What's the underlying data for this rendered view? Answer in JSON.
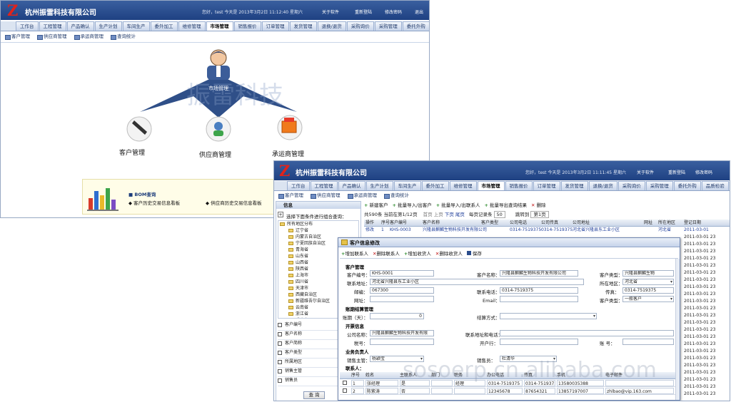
{
  "app": {
    "company": "杭州振雷科技有限公司",
    "logo_letter": "Z",
    "welcome_main": "您好，test 今天是 2013年3月2日 11:12:40 星期六",
    "welcome_detail": "您好，test 今天是 2013年3月2日 11:11:45 星期六",
    "links": [
      "关于软件",
      "重新登陆",
      "修改密码",
      "退出"
    ]
  },
  "tabs_main": [
    "工作台",
    "工程管理",
    "产品确认",
    "生产计划",
    "车间生产",
    "委外加工",
    "维修管理",
    "市场管理",
    "销售报价",
    "订单管理",
    "发货管理",
    "退换/退货",
    "采购询价",
    "采购管理",
    "委托外购"
  ],
  "tabs_detail": [
    "工作台",
    "工程管理",
    "产品确认",
    "生产计划",
    "车间生产",
    "委外加工",
    "维修管理",
    "市场管理",
    "销售报价",
    "订单管理",
    "发货管理",
    "退换/退货",
    "采购询价",
    "采购管理",
    "委托外购",
    "品质检验",
    "应付账款",
    "物料管理"
  ],
  "active_tab": "市场管理",
  "subnav": [
    "客户管理",
    "供应商管理",
    "承运商管理",
    "查询统计"
  ],
  "diagram": {
    "center": "市场管理",
    "nodes": [
      "客户管理",
      "供应商管理",
      "承运商管理"
    ]
  },
  "bom": {
    "title": "BOM查询",
    "links": [
      "客户历史交易信息看板",
      "供应商历史交易信息看板"
    ]
  },
  "sidebar": {
    "title": "信息",
    "hint": "选择下面条件进行组合查询：",
    "root": "所有地区分布",
    "regions": [
      "辽宁省",
      "内蒙古自治区",
      "宁夏回族自治区",
      "青海省",
      "山东省",
      "山西省",
      "陕西省",
      "上海市",
      "四川省",
      "天津市",
      "西藏自治区",
      "新疆维吾尔自治区",
      "云南省",
      "浙江省",
      "重庆市"
    ],
    "filters": [
      "客户编号",
      "客户名称",
      "客户简称",
      "客户类型",
      "所属地区",
      "销售主管",
      "销售员"
    ],
    "query_button": "查 询"
  },
  "list_toolbar": [
    "新建客户",
    "批量导入/出客户",
    "批量导入/出联系人",
    "批量导出查询结果",
    "删除"
  ],
  "pager": {
    "summary": "共590条 当前在第1/12页",
    "nav": [
      "首页",
      "上页",
      "下页",
      "尾页"
    ],
    "page_size_label": "每页记录条",
    "page_size": "50",
    "jump_label": "跳转到",
    "jump_value": "第1页"
  },
  "list_headers": [
    "操作",
    "序号",
    "客户编号",
    "客户名称",
    "客户类型",
    "公司电话",
    "公司传真",
    "公司地址",
    "网址",
    "所在地区",
    "登记日期"
  ],
  "list_row": [
    "修改",
    "1",
    "KHS-0003",
    "兴隆县麒麟生物科技开发有限公司",
    "",
    "0314-7519375",
    "0314-7519375",
    "河北省兴隆县东工业小区",
    "",
    "河北省",
    "2011-03-01"
  ],
  "dates": [
    "2011-03-01 23",
    "2011-03-01 23",
    "2011-03-01 23",
    "2011-03-01 23",
    "2011-03-01 23",
    "2011-03-01 23",
    "2011-03-01 23",
    "2011-03-01 23",
    "2011-03-01 23",
    "2011-03-01 23",
    "2011-03-01 23",
    "2011-03-01 23",
    "2011-03-01 23",
    "2011-03-01 23",
    "2011-03-01 23",
    "2011-03-01 23",
    "2011-03-01 23",
    "2011-03-01 23",
    "2011-03-01 23",
    "2011-03-01 23",
    "2011-03-01 23",
    "2011-03-01 23",
    "2011-03-01 23"
  ],
  "modal": {
    "title": "客户信息修改",
    "toolbar": [
      "增加联系人",
      "删除联系人",
      "增加收货人",
      "删除收货人",
      "保存"
    ],
    "sec_customer": "客户管理",
    "labels": {
      "code": "客户编号：",
      "name": "客户名称：",
      "type": "客户类型：",
      "address": "联系地址：",
      "region": "所在地区：",
      "postcode": "邮编：",
      "phone": "联系电话：",
      "fax": "传真：",
      "website": "网址：",
      "email": "Email：",
      "category": "客户类型："
    },
    "values": {
      "code": "KHS-0001",
      "name": "兴隆县麒麟生物科技开发有限公司",
      "type": "兴隆县麒麟生物",
      "address": "河北省兴隆县东工业小区",
      "region": "河北省",
      "postcode": "067300",
      "phone": "0314-7519375",
      "fax": "0314-7519375",
      "category": "一般客户"
    },
    "sec_settle": "账期结算管理",
    "settle_days_label": "账期（天）：",
    "settle_days": "0",
    "settle_method_label": "结算方式：",
    "sec_invoice": "开票信息",
    "invoice_name_label": "公司名称：",
    "invoice_name": "兴隆县麒麟生物科技开发有限",
    "invoice_addr_label": "联系地址和电话：",
    "tax_label": "税号：",
    "bank_label": "开户行：",
    "account_label": "账  号：",
    "sec_sales": "业务负责人",
    "sales_mgr_label": "销售主管：",
    "sales_mgr": "杨颖宝",
    "salesman_label": "销售员：",
    "salesman": "杜清华",
    "contact_label": "联系人：",
    "contact_headers": [
      "",
      "序号",
      "姓名",
      "主联系人",
      "部门",
      "职务",
      "办公电话",
      "传真",
      "手机",
      "电子邮件"
    ],
    "contacts": [
      [
        "",
        "1",
        "张经理",
        "是",
        "",
        "经理",
        "0314-7519375",
        "0314-7519375",
        "13580035388",
        ""
      ],
      [
        "",
        "2",
        "陈紫涛",
        "否",
        "",
        "",
        "12345678",
        "87654321",
        "13857197007",
        "zhlbao@vip.163.com"
      ]
    ]
  },
  "watermarks": [
    "振雷科技",
    "sosoerp.cn.alibaba.com"
  ]
}
